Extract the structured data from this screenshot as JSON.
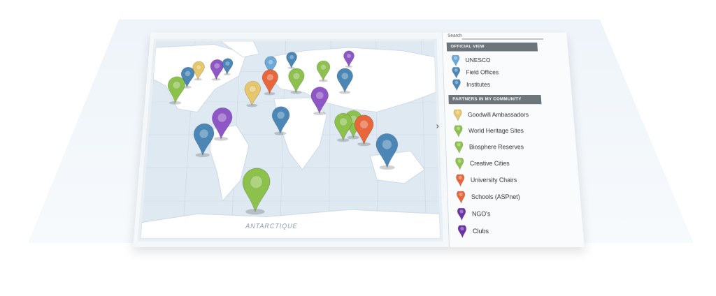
{
  "map": {
    "ocean_label": "ANTARCTIQUE",
    "colors": {
      "water": "#dfe9f2",
      "land": "#ffffff",
      "grid": "#c9d6e2"
    }
  },
  "sidebar": {
    "search_label": "Search",
    "search_value": "",
    "official_header": "OFFICIAL VIEW",
    "official_items": [
      {
        "label": "UNESCO",
        "color": "#6aa9d9"
      },
      {
        "label": "Field Offices",
        "color": "#4a87b7"
      },
      {
        "label": "Institutes",
        "color": "#4a87b7"
      }
    ],
    "partners_header": "PARTNERS IN MY COMMUNITY",
    "partner_items": [
      {
        "label": "Goodwill Ambassadors",
        "color": "#e8c76a"
      },
      {
        "label": "World Heritage Sites",
        "color": "#8cc24b"
      },
      {
        "label": "Biosphere Reserves",
        "color": "#8cc24b"
      },
      {
        "label": "Creative Cities",
        "color": "#8cc24b"
      },
      {
        "label": "University Chairs",
        "color": "#e8663a"
      },
      {
        "label": "Schools (ASPnet)",
        "color": "#e8663a"
      },
      {
        "label": "NGO's",
        "color": "#6b33a8"
      },
      {
        "label": "Clubs",
        "color": "#6b33a8"
      }
    ]
  },
  "pins": [
    {
      "category": "Field Offices",
      "color": "#4a87b7"
    },
    {
      "category": "Goodwill Ambassadors",
      "color": "#e8c76a"
    },
    {
      "category": "NGO's",
      "color": "#8e56c6"
    },
    {
      "category": "Institutes",
      "color": "#4a87b7"
    },
    {
      "category": "UNESCO",
      "color": "#6aa9d9"
    },
    {
      "category": "Field Offices",
      "color": "#4a87b7"
    },
    {
      "category": "Clubs",
      "color": "#8e56c6"
    },
    {
      "category": "Creative Cities",
      "color": "#8cc24b"
    },
    {
      "category": "World Heritage Sites",
      "color": "#8cc24b"
    },
    {
      "category": "Goodwill Ambassadors",
      "color": "#e8c76a"
    },
    {
      "category": "University Chairs",
      "color": "#e8663a"
    },
    {
      "category": "Biosphere Reserves",
      "color": "#8cc24b"
    },
    {
      "category": "NGO's",
      "color": "#8e56c6"
    },
    {
      "category": "Field Offices",
      "color": "#4a87b7"
    },
    {
      "category": "Creative Cities",
      "color": "#8cc24b"
    },
    {
      "category": "Clubs",
      "color": "#8e56c6"
    },
    {
      "category": "Field Offices",
      "color": "#4a87b7"
    },
    {
      "category": "Field Offices",
      "color": "#4a87b7"
    },
    {
      "category": "World Heritage Sites",
      "color": "#8cc24b"
    },
    {
      "category": "Schools (ASPnet)",
      "color": "#e8663a"
    },
    {
      "category": "Field Offices",
      "color": "#4a87b7"
    },
    {
      "category": "Biosphere Reserves",
      "color": "#8cc24b"
    }
  ]
}
